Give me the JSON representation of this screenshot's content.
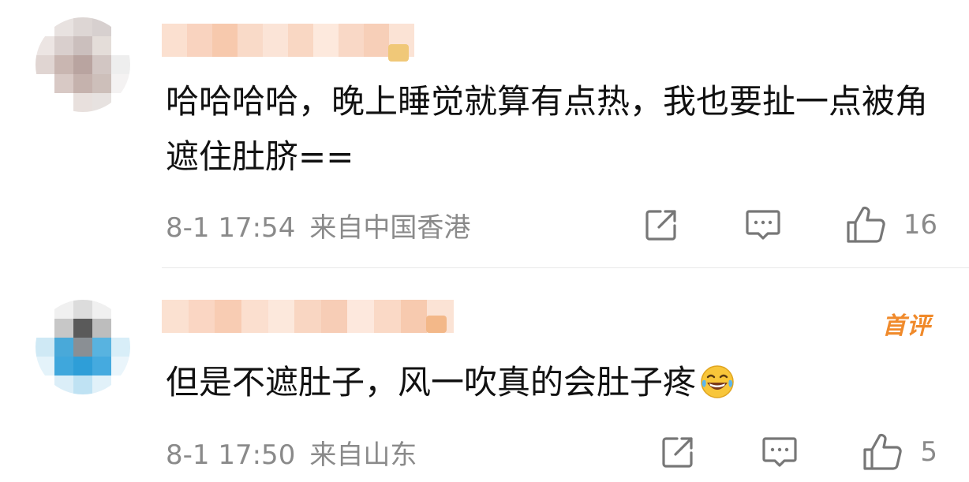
{
  "comments": [
    {
      "text": "哈哈哈哈，晚上睡觉就算有点热，我也要扯一点被角遮住肚脐==",
      "time": "8-1 17:54",
      "location": "来自中国香港",
      "likes": "16",
      "first_badge": "",
      "avatar_colors": [
        "#ffffff",
        "#e8e2e0",
        "#ddd6d4",
        "#d7d0cf",
        "#ffffff",
        "#ece5e3",
        "#d9cfcd",
        "#cbbfbd",
        "#e4ddd9",
        "#ffffff",
        "#e0d5d2",
        "#c9b6b1",
        "#b9a4a0",
        "#d2c6c3",
        "#eeeeee",
        "#ffffff",
        "#d8c9c5",
        "#c5b2ad",
        "#cdbfba",
        "#f4f2f2",
        "#ffffff",
        "#ffffff",
        "#e8e0dd",
        "#e7e2e0",
        "#ffffff"
      ],
      "username_colors": [
        "#fbe0d0",
        "#f9d3bf",
        "#f7c9ad",
        "#f9dac8",
        "#fbe4d7",
        "#f9d7c3",
        "#fde9dd",
        "#f9d8c6",
        "#f7cfb8",
        "#fbe3d5"
      ]
    },
    {
      "text": "但是不遮肚子，风一吹真的会肚子疼",
      "time": "8-1 17:50",
      "location": "来自山东",
      "likes": "5",
      "first_badge": "首评",
      "avatar_colors": [
        "#ffffff",
        "#f0f0f0",
        "#dcdcdc",
        "#f0f0f0",
        "#ffffff",
        "#ffffff",
        "#c7c7c7",
        "#5a5a5a",
        "#bdbdbd",
        "#ffffff",
        "#cfe9f5",
        "#49a9d9",
        "#8a8f94",
        "#58b3e0",
        "#d8eef8",
        "#e4f3fa",
        "#3fa7dc",
        "#2e9ed8",
        "#45aadf",
        "#eaf5fb",
        "#ffffff",
        "#dbeef8",
        "#bfe2f3",
        "#e1f1f9",
        "#ffffff"
      ],
      "username_colors": [
        "#fbe1d1",
        "#fad6c3",
        "#f8ccb3",
        "#fbdfcf",
        "#fce8dc",
        "#f9d6c2",
        "#f7cdb6",
        "#fde8dd",
        "#fad9c6",
        "#f7caaf",
        "#fbe3d5"
      ]
    }
  ],
  "colors": {
    "meta_gray": "#8a8a8a",
    "first_badge_orange": "#f08a2b",
    "icon_gray": "#777777"
  },
  "icons": {
    "share": "share-icon",
    "reply": "comment-icon",
    "like": "thumbs-up-icon",
    "emoji": "laughing-tears-emoji"
  }
}
